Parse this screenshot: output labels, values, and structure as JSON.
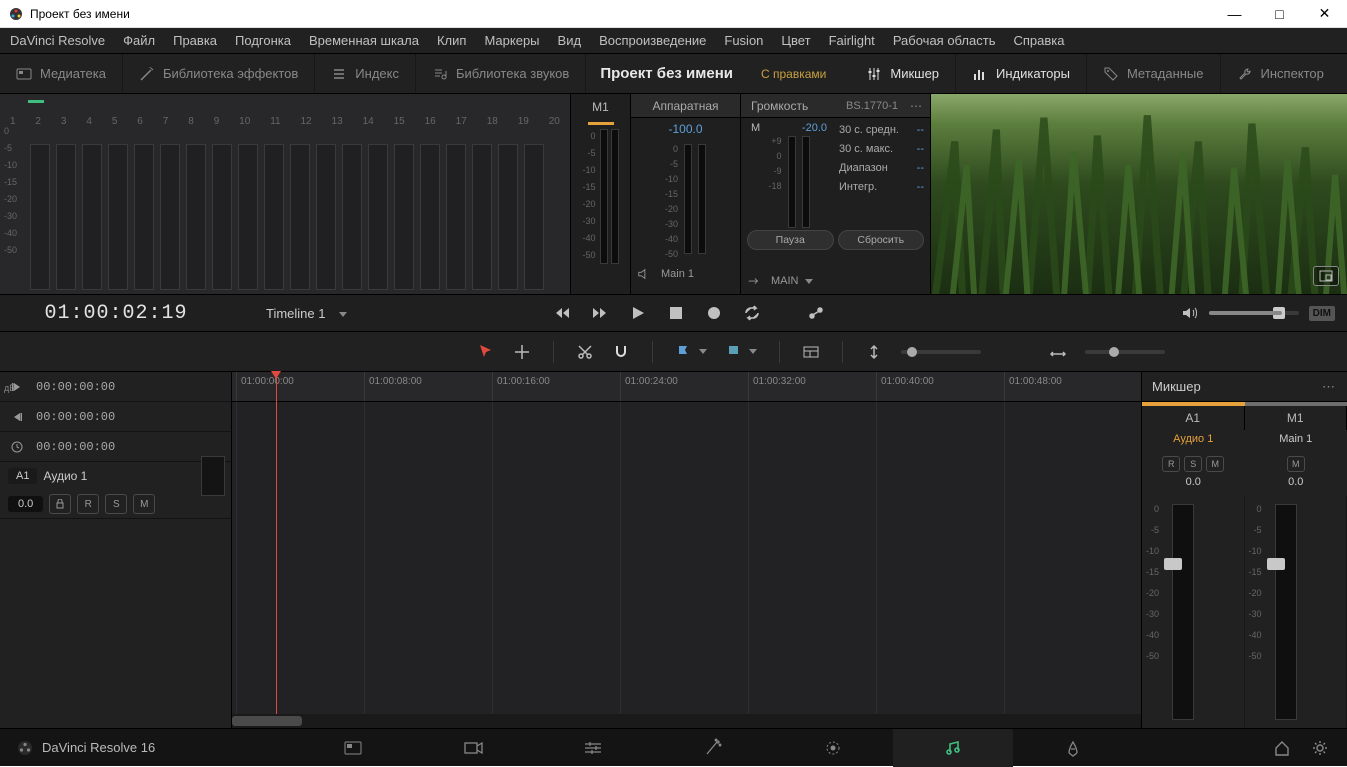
{
  "window": {
    "title": "Проект без имени"
  },
  "menu": [
    "DaVinci Resolve",
    "Файл",
    "Правка",
    "Подгонка",
    "Временная шкала",
    "Клип",
    "Маркеры",
    "Вид",
    "Воспроизведение",
    "Fusion",
    "Цвет",
    "Fairlight",
    "Рабочая область",
    "Справка"
  ],
  "toolbar": {
    "media": "Медиатека",
    "fxlib": "Библиотека эффектов",
    "index": "Индекс",
    "soundlib": "Библиотека звуков",
    "project": "Проект без имени",
    "status": "С правками",
    "mixer": "Микшер",
    "indicators": "Индикаторы",
    "metadata": "Метаданные",
    "inspector": "Инспектор"
  },
  "meters": {
    "channels": [
      "1",
      "2",
      "3",
      "4",
      "5",
      "6",
      "7",
      "8",
      "9",
      "10",
      "11",
      "12",
      "13",
      "14",
      "15",
      "16",
      "17",
      "18",
      "19",
      "20"
    ],
    "scale": [
      "0",
      "-5",
      "-10",
      "-15",
      "-20",
      "-30",
      "-40",
      "-50"
    ]
  },
  "m1": {
    "label": "M1",
    "scale": [
      "0",
      "-5",
      "-10",
      "-15",
      "-20",
      "-30",
      "-40",
      "-50"
    ]
  },
  "hardware": {
    "title": "Аппаратная",
    "value": "-100.0",
    "scale": [
      "0",
      "-5",
      "-10",
      "-15",
      "-20",
      "-30",
      "-40",
      "-50"
    ],
    "route_in": "Main 1",
    "route_out": "MAIN"
  },
  "loudness": {
    "title": "Громкость",
    "spec": "BS.1770-1",
    "m_label": "M",
    "m_value": "-20.0",
    "scale": [
      "+9",
      "0",
      "-9",
      "-18"
    ],
    "rows": [
      {
        "label": "30 с. средн.",
        "value": "--"
      },
      {
        "label": "30 с. макс.",
        "value": "--"
      },
      {
        "label": "Диапазон",
        "value": "--"
      },
      {
        "label": "Интегр.",
        "value": "--"
      }
    ],
    "pause": "Пауза",
    "reset": "Сбросить"
  },
  "transport": {
    "timecode": "01:00:02:19",
    "timeline_name": "Timeline 1",
    "dim": "DIM"
  },
  "trackhead": {
    "rows": [
      {
        "icon": "tc-start",
        "tc": "00:00:00:00"
      },
      {
        "icon": "tc-end",
        "tc": "00:00:00:00"
      },
      {
        "icon": "clock",
        "tc": "00:00:00:00"
      }
    ],
    "track": {
      "id": "A1",
      "name": "Аудио 1",
      "value": "0.0",
      "r": "R",
      "s": "S",
      "m": "M"
    }
  },
  "ruler": [
    "01:00:00:00",
    "01:00:08:00",
    "01:00:16:00",
    "01:00:24:00",
    "01:00:32:00",
    "01:00:40:00",
    "01:00:48:00"
  ],
  "mixer": {
    "title": "Микшер",
    "bus": [
      "A1",
      "M1"
    ],
    "labels": [
      "Аудио 1",
      "Main 1"
    ],
    "rsm": [
      "R",
      "S",
      "M"
    ],
    "m_only": "M",
    "vals": [
      "0.0",
      "0.0"
    ],
    "scale": [
      "0",
      "-5",
      "-10",
      "-15",
      "-20",
      "-30",
      "-40",
      "-50"
    ],
    "db": "дБ"
  },
  "footer": {
    "brand": "DaVinci Resolve 16"
  }
}
